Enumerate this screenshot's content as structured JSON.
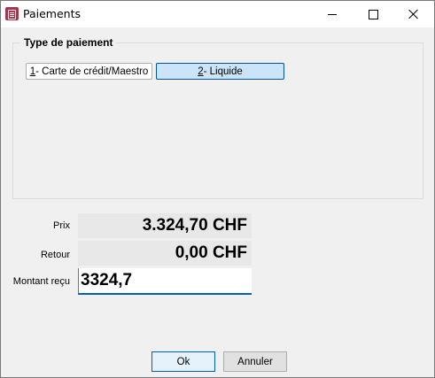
{
  "window": {
    "title": "Paiements"
  },
  "titlebar": {
    "icon": "app-icon",
    "controls": [
      "minimize-icon",
      "maximize-icon",
      "close-icon"
    ]
  },
  "group": {
    "legend": "Type de paiement"
  },
  "payment_buttons": [
    {
      "key": "1",
      "label": " - Carte de crédit/Maestro",
      "selected": false
    },
    {
      "key": "2",
      "label": " - Liquide",
      "selected": true
    }
  ],
  "fields": {
    "price_label": "Prix",
    "price_value": "3.324,70 CHF",
    "return_label": "Retour",
    "return_value": "0,00 CHF",
    "received_label": "Montant reçu",
    "received_value": "3324,7"
  },
  "buttons": {
    "ok": "Ok",
    "cancel": "Annuler"
  },
  "colors": {
    "selected_bg": "#cce4f7",
    "selected_border": "#005499",
    "focus_accent": "#005fb8"
  }
}
